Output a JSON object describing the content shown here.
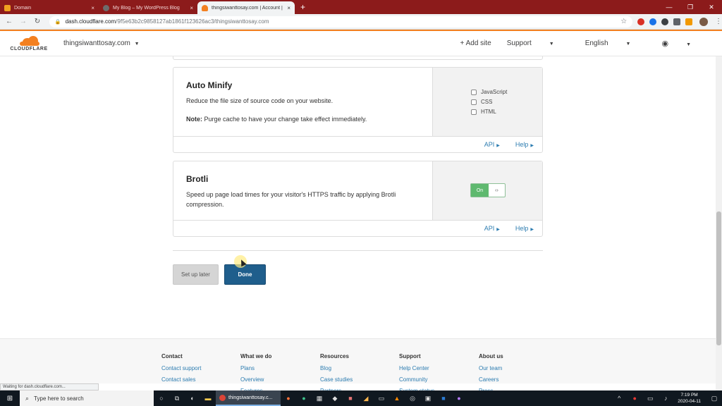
{
  "browser": {
    "tabs": [
      {
        "title": "Domain",
        "fav_color": "#f0a020",
        "active": false
      },
      {
        "title": "My Blog – My WordPress Blog",
        "fav_color": "#6d6d6d",
        "active": false
      },
      {
        "title": "thingsiwanttosay.com | Account | Cl",
        "fav_color": "#f38020",
        "active": true
      }
    ],
    "tab_close": "×",
    "new_tab": "+",
    "url_host": "dash.cloudflare.com",
    "url_path": "/9f5e63b2c9858127ab1861f123626ac3/thingsiwanttosay.com",
    "status_text": "Waiting for dash.cloudflare.com..."
  },
  "header": {
    "brand": "CLOUDFLARE",
    "site": "thingsiwanttosay.com",
    "add_site": "+ Add site",
    "support": "Support",
    "language": "English"
  },
  "cards": {
    "auto_minify": {
      "title": "Auto Minify",
      "description": "Reduce the file size of source code on your website.",
      "note_label": "Note:",
      "note_text": " Purge cache to have your change take effect immediately.",
      "options": [
        "JavaScript",
        "CSS",
        "HTML"
      ],
      "api": "API",
      "help": "Help"
    },
    "brotli": {
      "title": "Brotli",
      "description": "Speed up page load times for your visitor's HTTPS traffic by applying Brotli compression.",
      "toggle_label": "On",
      "toggle_knob": "‹›",
      "api": "API",
      "help": "Help"
    }
  },
  "actions": {
    "later": "Set up later",
    "done": "Done"
  },
  "footer": {
    "columns": [
      {
        "heading": "Contact",
        "links": [
          "Contact support",
          "Contact sales"
        ]
      },
      {
        "heading": "What we do",
        "links": [
          "Plans",
          "Overview",
          "Features"
        ]
      },
      {
        "heading": "Resources",
        "links": [
          "Blog",
          "Case studies",
          "Partners"
        ]
      },
      {
        "heading": "Support",
        "links": [
          "Help Center",
          "Community",
          "System status"
        ]
      },
      {
        "heading": "About us",
        "links": [
          "Our team",
          "Careers",
          "Press"
        ]
      }
    ]
  },
  "taskbar": {
    "search_placeholder": "Type here to search",
    "chrome_label": "thingsiwanttosay.c...",
    "time": "7:19 PM",
    "date": "2020-04-11"
  }
}
